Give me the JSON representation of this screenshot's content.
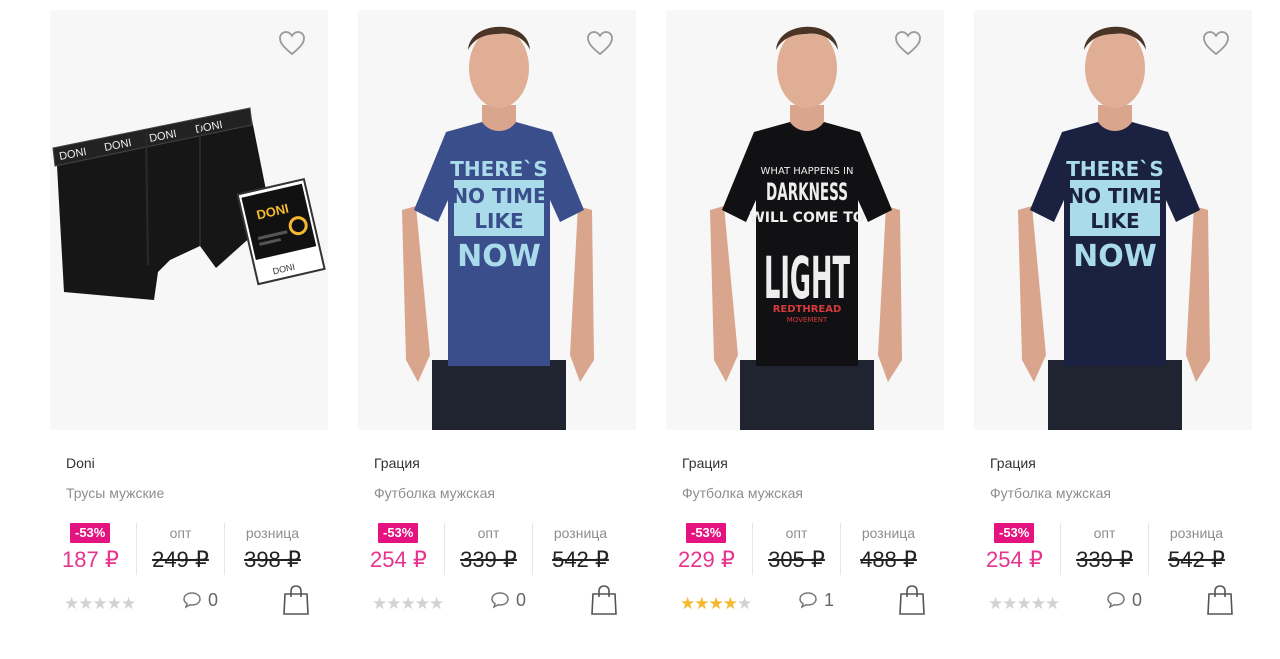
{
  "labels": {
    "opt": "опт",
    "retail": "розница"
  },
  "colors": {
    "accent": "#e5338e",
    "badge": "#e4137f",
    "star_on": "#f5b82e",
    "star_off": "#d2d2d2"
  },
  "icons": {
    "favorite": "heart-icon",
    "comments": "comment-icon",
    "cart": "shopping-bag-icon",
    "rating": "star-icon"
  },
  "products": [
    {
      "brand": "Doni",
      "title": "Трусы мужские",
      "discount": "-53%",
      "price": "187 ₽",
      "opt_price": "249 ₽",
      "retail_price": "398 ₽",
      "rating": 0,
      "comments": "0"
    },
    {
      "brand": "Грация",
      "title": "Футболка мужская",
      "discount": "-53%",
      "price": "254 ₽",
      "opt_price": "339 ₽",
      "retail_price": "542 ₽",
      "rating": 0,
      "comments": "0",
      "tshirt_print": [
        "THERE`S",
        "NO TIME",
        "LIKE",
        "NOW"
      ]
    },
    {
      "brand": "Грация",
      "title": "Футболка мужская",
      "discount": "-53%",
      "price": "229 ₽",
      "opt_price": "305 ₽",
      "retail_price": "488 ₽",
      "rating": 4,
      "comments": "1",
      "tshirt_print": [
        "WHAT HAPPENS IN",
        "DARKNESS",
        "WILL COME TO",
        "LIGHT",
        "REDTHREAD",
        "MOVEMENT"
      ]
    },
    {
      "brand": "Грация",
      "title": "Футболка мужская",
      "discount": "-53%",
      "price": "254 ₽",
      "opt_price": "339 ₽",
      "retail_price": "542 ₽",
      "rating": 0,
      "comments": "0",
      "tshirt_print": [
        "THERE`S",
        "NO TIME",
        "LIKE",
        "NOW"
      ]
    }
  ],
  "package_label": "DONI",
  "waistband_text": "DONI"
}
